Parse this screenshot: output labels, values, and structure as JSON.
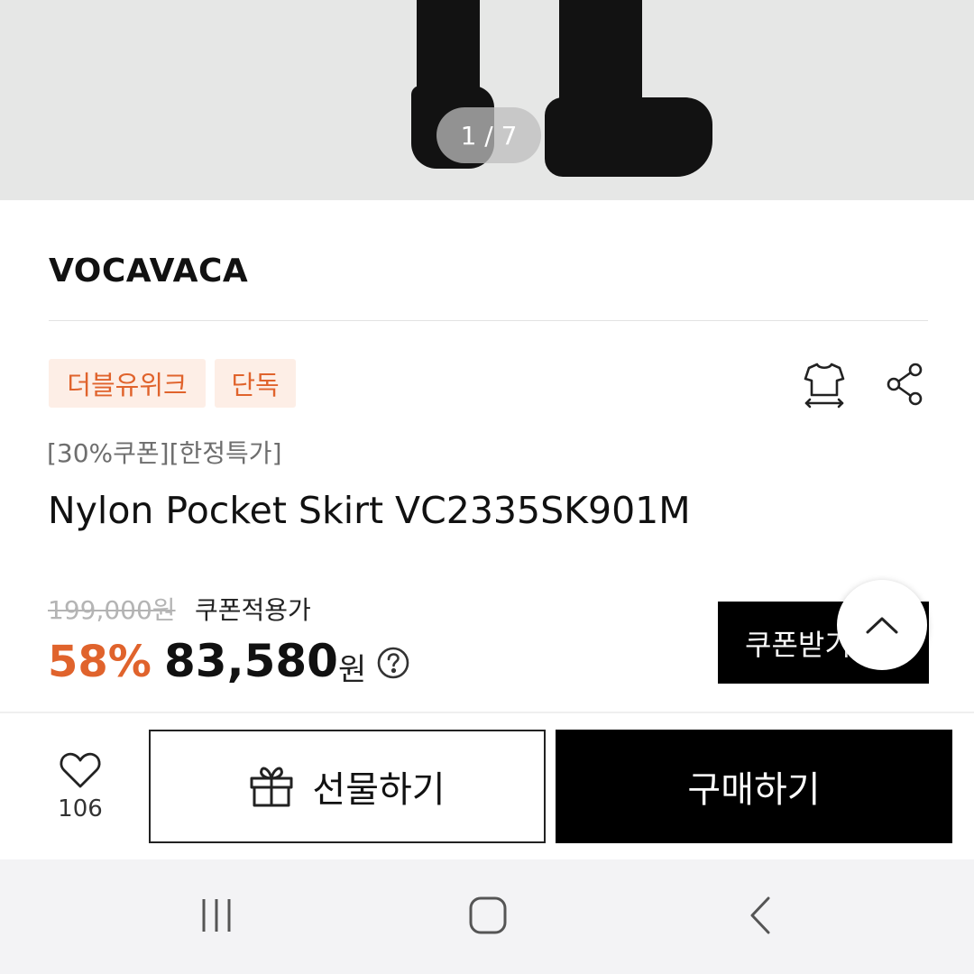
{
  "gallery": {
    "counter": "1 / 7"
  },
  "brand": "VOCAVACA",
  "badges": [
    "더블유위크",
    "단독"
  ],
  "product": {
    "subtitle": "[30%쿠폰][한정특가]",
    "title": "Nylon Pocket Skirt VC2335SK901M"
  },
  "price": {
    "original": "199,000원",
    "coupon_label": "쿠폰적용가",
    "discount": "58%",
    "final": "83,580",
    "currency": "원"
  },
  "actions": {
    "coupon_button": "쿠폰받기",
    "like_count": "106",
    "gift_button": "선물하기",
    "buy_button": "구매하기"
  },
  "icons": {
    "size_guide": "tshirt-size-icon",
    "share": "share-icon",
    "help": "question-circle-icon",
    "scroll_top": "chevron-up-icon",
    "like": "heart-icon",
    "gift": "gift-icon",
    "nav_recent": "recent-apps-icon",
    "nav_home": "home-icon",
    "nav_back": "back-icon"
  },
  "colors": {
    "accent": "#e0632c",
    "badge_bg": "#fdeee6",
    "primary": "#000000"
  }
}
